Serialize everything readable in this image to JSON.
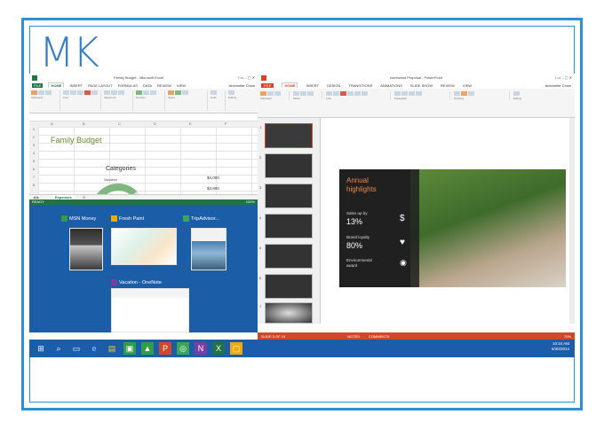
{
  "logo": {
    "text": "MK"
  },
  "excel": {
    "title": "Family Budget - Microsoft Excel",
    "tabs": [
      "FILE",
      "HOME",
      "INSERT",
      "PAGE LAYOUT",
      "FORMULAS",
      "DATA",
      "REVIEW",
      "VIEW"
    ],
    "user": "Antoinette Chow",
    "groups": [
      "Clipboard",
      "Font",
      "Alignment",
      "Number",
      "Styles",
      "Cells",
      "Editing"
    ],
    "columns": [
      "A",
      "B",
      "C",
      "D",
      "E",
      "F",
      "G",
      "H"
    ],
    "rows": [
      "1",
      "2",
      "3",
      "4",
      "5",
      "6",
      "7",
      "8"
    ],
    "sheet_title": "Family Budget",
    "chart_title": "Categories",
    "chart_item": "Vacation",
    "amount1": "$4,000",
    "amount2": "$3,800",
    "sheet_tab": "Expenses",
    "status": "READY",
    "zoom": "100%"
  },
  "taskview": {
    "apps": [
      {
        "label": "MSN Money",
        "color": "#2f9e44"
      },
      {
        "label": "Fresh Paint",
        "color": "#f2a900"
      },
      {
        "label": "TripAdvisor...",
        "color": "#3aa757"
      },
      {
        "label": "Vacation - OneNote",
        "color": "#7a3ea0"
      }
    ]
  },
  "ppt": {
    "title": "Northwind Proposal - PowerPoint",
    "tabs": [
      "FILE",
      "HOME",
      "INSERT",
      "DESIGN",
      "TRANSITIONS",
      "ANIMATIONS",
      "SLIDE SHOW",
      "REVIEW",
      "VIEW"
    ],
    "user": "Antoinette Chow",
    "groups": [
      "Clipboard",
      "Slides",
      "Font",
      "Paragraph",
      "Drawing",
      "Editing"
    ],
    "slide_numbers": [
      "1",
      "2",
      "3",
      "4",
      "5",
      "6",
      "7"
    ],
    "slide": {
      "title_line1": "Annual",
      "title_line2": "highlights",
      "stat1_label": "Sales up by",
      "stat1_value": "13%",
      "stat2_label": "Brand loyalty",
      "stat2_value": "80%",
      "stat3_label": "Environmental",
      "stat3_label2": "award"
    },
    "status_left": "SLIDE 3 OF 15",
    "status_notes": "NOTES",
    "status_comments": "COMMENTS",
    "zoom": "70%"
  },
  "taskbar": {
    "time": "10:24 AM",
    "date": "6/30/2014"
  },
  "colors": {
    "excel_green": "#217346",
    "ppt_orange": "#d24726",
    "taskbar_blue": "#1b5dab",
    "frame_blue": "#2f8fd6"
  }
}
